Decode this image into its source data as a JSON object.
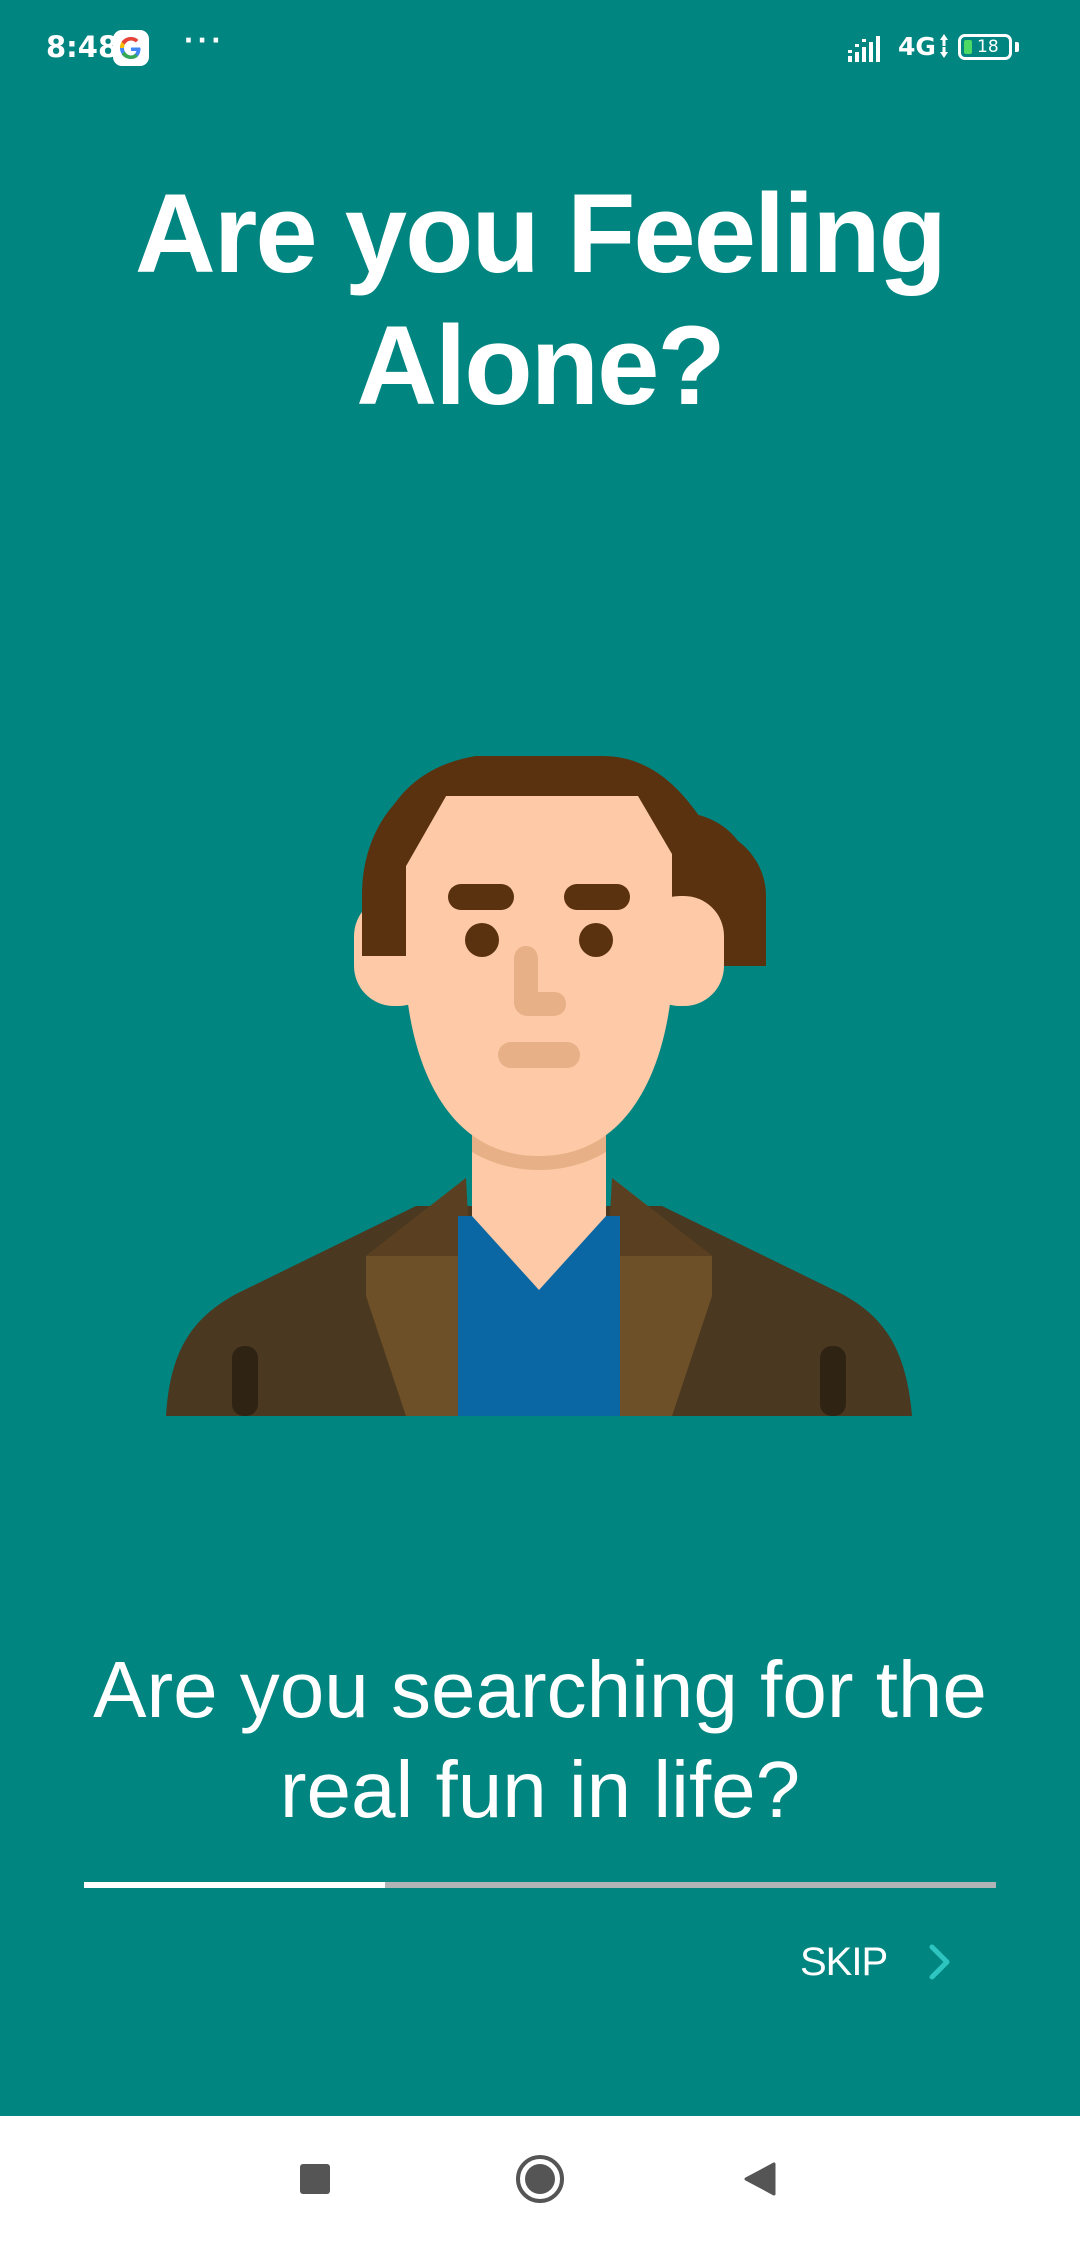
{
  "status_bar": {
    "time": "8:48",
    "notification_icon": "google-g-icon",
    "more_icon": "more-dots-icon",
    "more_label": "···",
    "signal_icon": "signal-icon",
    "network_type": "4G",
    "battery_level": "18",
    "battery_icon": "battery-icon"
  },
  "onboarding": {
    "title": "Are you Feeling Alone?",
    "illustration_icon": "man-avatar-illustration",
    "subtitle": "Are you searching for the real fun in life?",
    "progress": 0.33,
    "skip_label": "SKIP",
    "skip_icon": "chevron-right-icon"
  },
  "navigation_bar": {
    "recents_icon": "square-icon",
    "home_icon": "circle-icon",
    "back_icon": "triangle-back-icon"
  },
  "colors": {
    "background": "#008580",
    "progress_track": "#b0b4b6",
    "progress_fill": "#ffffff",
    "skip_arrow": "#2ec4c0",
    "nav_bar": "#ffffff",
    "nav_icons": "#555555"
  }
}
